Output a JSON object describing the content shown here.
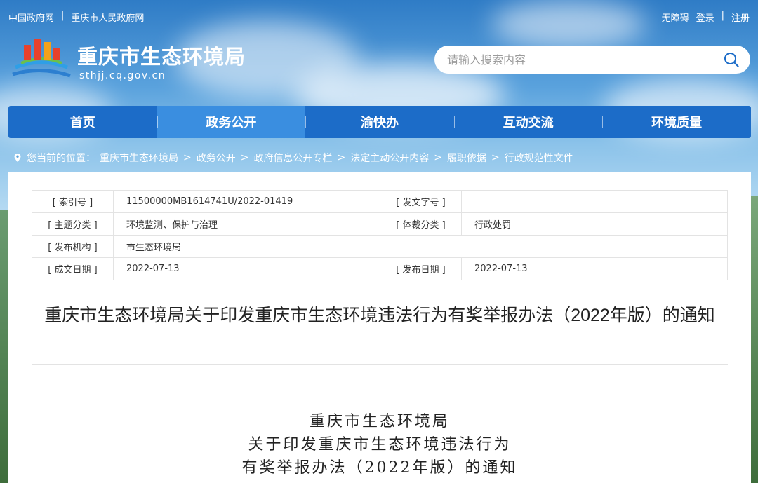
{
  "top_links": [
    "中国政府网",
    "重庆市人民政府网"
  ],
  "top_sep": "|",
  "user_links": {
    "accessibility": "无障碍",
    "login": "登录",
    "register": "注册"
  },
  "site": {
    "name": "重庆市生态环境局",
    "domain": "sthjj.cq.gov.cn"
  },
  "search": {
    "placeholder": "请输入搜索内容"
  },
  "nav": [
    {
      "label": "首页",
      "active": false
    },
    {
      "label": "政务公开",
      "active": true
    },
    {
      "label": "渝快办",
      "active": false
    },
    {
      "label": "互动交流",
      "active": false
    },
    {
      "label": "环境质量",
      "active": false
    }
  ],
  "breadcrumb": {
    "prefix": "您当前的位置：",
    "items": [
      "重庆市生态环境局",
      "政务公开",
      "政府信息公开专栏",
      "法定主动公开内容",
      "履职依据",
      "行政规范性文件"
    ],
    "sep": ">"
  },
  "meta": {
    "index_label": "[ 索引号 ]",
    "index_value": "11500000MB1614741U/2022-01419",
    "doc_no_label": "[ 发文字号 ]",
    "doc_no_value": "",
    "topic_label": "[ 主题分类 ]",
    "topic_value": "环境监测、保护与治理",
    "genre_label": "[ 体裁分类 ]",
    "genre_value": "行政处罚",
    "issuer_label": "[ 发布机构 ]",
    "issuer_value": "市生态环境局",
    "created_label": "[ 成文日期 ]",
    "created_value": "2022-07-13",
    "published_label": "[ 发布日期 ]",
    "published_value": "2022-07-13"
  },
  "document": {
    "title": "重庆市生态环境局关于印发重庆市生态环境违法行为有奖举报办法（2022年版）的通知",
    "head_line1": "重庆市生态环境局",
    "head_line2": "关于印发重庆市生态环境违法行为",
    "head_line3": "有奖举报办法（2022年版）的通知"
  },
  "colors": {
    "nav": "#1c6cc8",
    "nav_active": "#3a8ee0"
  }
}
